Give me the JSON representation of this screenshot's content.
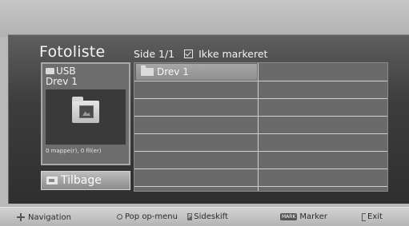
{
  "header": {
    "title": "Fotoliste",
    "page_label": "Side 1/1",
    "mark_status": "Ikke markeret"
  },
  "info_panel": {
    "device": "USB",
    "drive": "Drev 1",
    "count": "0 mappe(r), 0 fil(er)"
  },
  "back_button": {
    "label": "Tilbage"
  },
  "files": [
    {
      "name": "Drev 1",
      "type": "folder"
    }
  ],
  "help_bar": {
    "navigation": "Navigation",
    "popup": "Pop op-menu",
    "page_shift": "Sideskift",
    "mark_key": "MARK",
    "mark": "Marker",
    "exit": "Exit"
  }
}
